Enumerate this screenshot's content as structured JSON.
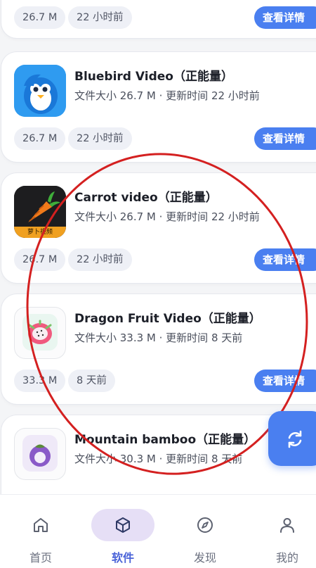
{
  "apps": [
    {
      "name": "",
      "meta": "",
      "size_chip": "26.7 M",
      "time_chip": "22 小时前",
      "button": "查看详情",
      "icon": "app-icon"
    },
    {
      "name": "Bluebird Video（正能量）",
      "meta": "文件大小 26.7 M · 更新时间 22 小时前",
      "size_chip": "26.7 M",
      "time_chip": "22 小时前",
      "button": "查看详情",
      "icon": "bluebird-app-icon"
    },
    {
      "name": "Carrot video（正能量）",
      "meta": "文件大小 26.7 M · 更新时间 22 小时前",
      "size_chip": "26.7 M",
      "time_chip": "22 小时前",
      "button": "查看详情",
      "icon": "carrot-app-icon",
      "icon_caption": "萝卜视频"
    },
    {
      "name": "Dragon Fruit Video（正能量）",
      "meta": "文件大小 33.3 M · 更新时间 8 天前",
      "size_chip": "33.3 M",
      "time_chip": "8 天前",
      "button": "查看详情",
      "icon": "dragon-fruit-app-icon"
    },
    {
      "name": "Mountain bamboo（正能量）",
      "meta": "文件大小 30.3 M · 更新时间 8 天前",
      "icon": "mangosteen-app-icon"
    }
  ],
  "fab": {
    "icon": "refresh-icon"
  },
  "nav": [
    {
      "label": "首页",
      "icon": "home-icon",
      "active": false
    },
    {
      "label": "软件",
      "icon": "cube-icon",
      "active": true
    },
    {
      "label": "发现",
      "icon": "compass-icon",
      "active": false
    },
    {
      "label": "我的",
      "icon": "user-icon",
      "active": false
    }
  ],
  "colors": {
    "accent": "#4a7ff0",
    "active_pill": "#e6dff6",
    "active_label": "#4a63d8",
    "annotation": "#d42020"
  }
}
